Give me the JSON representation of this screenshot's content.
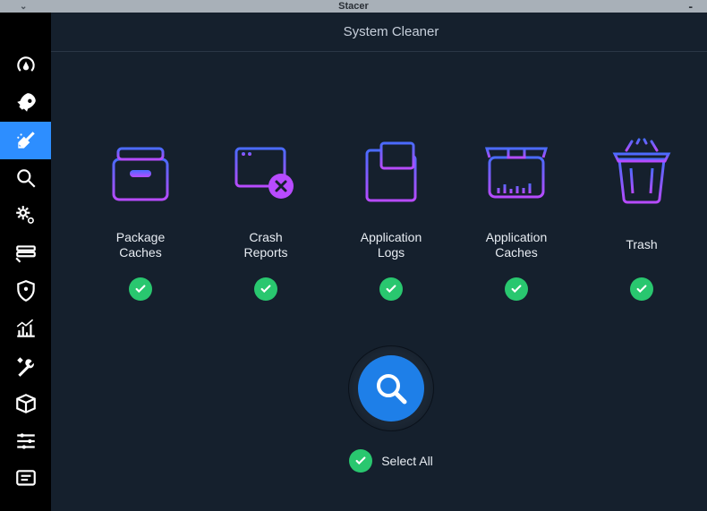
{
  "window": {
    "title": "Stacer"
  },
  "page": {
    "title": "System Cleaner"
  },
  "tiles": {
    "package_caches": "Package\nCaches",
    "crash_reports": "Crash\nReports",
    "app_logs": "Application\nLogs",
    "app_caches": "Application\nCaches",
    "trash": "Trash"
  },
  "actions": {
    "select_all": "Select All"
  }
}
